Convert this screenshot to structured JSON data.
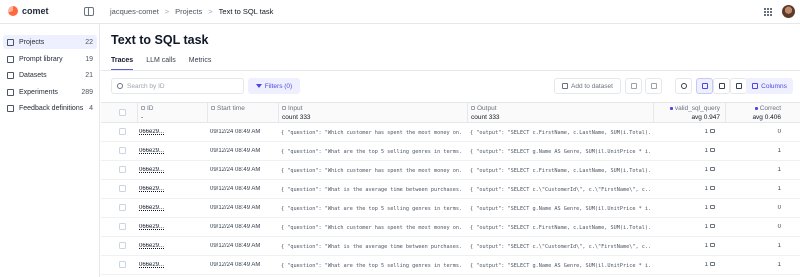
{
  "app": {
    "brand": "comet"
  },
  "breadcrumb": {
    "workspace": "jacques-comet",
    "section": "Projects",
    "current": "Text to SQL task",
    "sep": ">"
  },
  "sidebar": {
    "items": [
      {
        "label": "Projects",
        "count": "22",
        "active": true
      },
      {
        "label": "Prompt library",
        "count": "19"
      },
      {
        "label": "Datasets",
        "count": "21"
      },
      {
        "label": "Experiments",
        "count": "289"
      },
      {
        "label": "Feedback definitions",
        "count": "4"
      }
    ]
  },
  "page": {
    "title": "Text to SQL task",
    "tabs": [
      "Traces",
      "LLM calls",
      "Metrics"
    ]
  },
  "toolbar": {
    "search_placeholder": "Search by ID",
    "filters_label": "Filters (0)",
    "add_dataset_label": "Add to dataset",
    "columns_label": "Columns"
  },
  "table": {
    "headers": {
      "id": "ID",
      "id_sub": "-",
      "start_time": "Start time",
      "input": "Input",
      "input_sub": "count 333",
      "output": "Output",
      "output_sub": "count 333",
      "valid_sql": "valid_sql_query",
      "valid_sql_sub": "avg 0.947",
      "correct": "Correct",
      "correct_sub": "avg 0.406"
    },
    "rows": [
      {
        "id": "066e29...",
        "time": "09/12/24 08:49 AM",
        "input": "{ \"question\": \"Which customer has spent the most money on...",
        "output": "{ \"output\": \"SELECT c.FirstName, c.LastName, SUM(i.Total)...",
        "valid": "1",
        "correct": "0"
      },
      {
        "id": "066e29...",
        "time": "09/12/24 08:49 AM",
        "input": "{ \"question\": \"What are the top 5 selling genres in terms...",
        "output": "{ \"output\": \"SELECT g.Name AS Genre, SUM(il.UnitPrice * i...",
        "valid": "1",
        "correct": "1"
      },
      {
        "id": "066e29...",
        "time": "09/12/24 08:49 AM",
        "input": "{ \"question\": \"Which customer has spent the most money on...",
        "output": "{ \"output\": \"SELECT c.FirstName, c.LastName, SUM(i.Total)...",
        "valid": "1",
        "correct": "1"
      },
      {
        "id": "066e29...",
        "time": "09/12/24 08:49 AM",
        "input": "{ \"question\": \"What is the average time between purchases...",
        "output": "{ \"output\": \"SELECT c.\\\"CustomerId\\\", c.\\\"FirstName\\\", c...",
        "valid": "1",
        "correct": "1"
      },
      {
        "id": "066e29...",
        "time": "09/12/24 08:49 AM",
        "input": "{ \"question\": \"What are the top 5 selling genres in terms...",
        "output": "{ \"output\": \"SELECT g.Name AS Genre, SUM(il.UnitPrice * i...",
        "valid": "1",
        "correct": "0"
      },
      {
        "id": "066e29...",
        "time": "09/12/24 08:49 AM",
        "input": "{ \"question\": \"Which customer has spent the most money on...",
        "output": "{ \"output\": \"SELECT c.FirstName, c.LastName, SUM(i.Total)...",
        "valid": "1",
        "correct": "0"
      },
      {
        "id": "066e29...",
        "time": "09/12/24 08:49 AM",
        "input": "{ \"question\": \"What is the average time between purchases...",
        "output": "{ \"output\": \"SELECT c.\\\"CustomerId\\\", c.\\\"FirstName\\\", c...",
        "valid": "1",
        "correct": "1"
      },
      {
        "id": "066e29...",
        "time": "09/12/24 08:49 AM",
        "input": "{ \"question\": \"What are the top 5 selling genres in terms...",
        "output": "{ \"output\": \"SELECT g.Name AS Genre, SUM(il.UnitPrice * i...",
        "valid": "1",
        "correct": "1"
      }
    ]
  },
  "colors": {
    "accent": "#5b5bd6",
    "accent_bg": "#eef0ff",
    "border": "#e5e7eb"
  },
  "icons": [
    "comet-logo-icon",
    "sidebar-toggle-icon",
    "apps-grid-icon",
    "user-avatar",
    "projects-icon",
    "prompt-library-icon",
    "datasets-icon",
    "experiments-icon",
    "feedback-icon",
    "search-icon",
    "filter-icon",
    "refresh-icon",
    "trash-icon",
    "download-icon",
    "columns-icon",
    "feedback-comment-icon"
  ]
}
